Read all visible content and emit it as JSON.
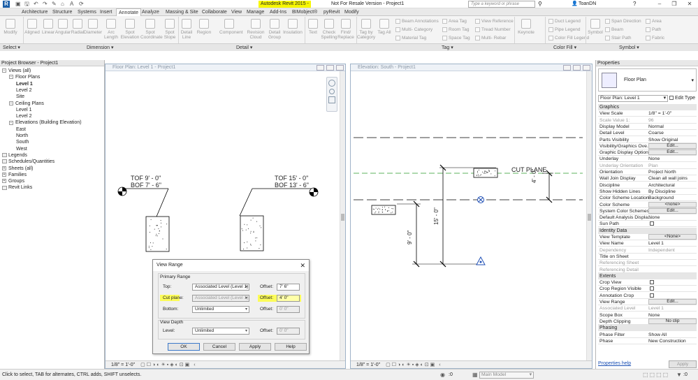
{
  "title_bar": {
    "app_title": "Autodesk Revit 2015 -",
    "suffix": "Not For Resale Version -   Project1",
    "search_placeholder": "Type a keyword or phrase",
    "user": "ToanDN",
    "quick_access": [
      "▣",
      "🖫",
      "↶",
      "↷",
      "✎",
      "⌂",
      "A",
      "⟳"
    ]
  },
  "ribbon_tabs": [
    "Architecture",
    "Structure",
    "Systems",
    "Insert",
    "Annotate",
    "Analyze",
    "Massing & Site",
    "Collaborate",
    "View",
    "Manage",
    "Add-Ins",
    "BIMobject®",
    "pyRevit",
    "Modify"
  ],
  "active_tab": "Annotate",
  "ribbon": {
    "tools_dimension": [
      "Modify",
      "Aligned",
      "Linear",
      "Angular",
      "Radial",
      "Diameter",
      "Arc Length",
      "Spot Elevation",
      "Spot Coordinate",
      "Spot Slope"
    ],
    "tools_detail": [
      "Detail Line",
      "Region",
      "Component",
      "Revision Cloud",
      "Detail Group",
      "Insulation"
    ],
    "tools_text": [
      "Text",
      "Check Spelling",
      "Find/ Replace"
    ],
    "tools_tag_big": [
      "Tag by Category",
      "Tag All"
    ],
    "tools_tag_small": [
      "Beam Annotations",
      "Multi- Category",
      "Material Tag",
      "Area Tag",
      "Room Tag",
      "Space Tag",
      "View Reference",
      "Tread Number",
      "Multi- Rebar"
    ],
    "tools_keynote": [
      "Keynote"
    ],
    "tools_color": [
      "Duct Legend",
      "Pipe Legend",
      "Color Fill Legend"
    ],
    "tools_symbol": [
      "Symbol",
      "Span Direction",
      "Beam",
      "Stair Path",
      "Area",
      "Path",
      "Fabric"
    ],
    "panels": [
      "Select",
      "Dimension",
      "Detail",
      "Tag",
      "Color Fill",
      "Symbol"
    ]
  },
  "project_browser": {
    "title": "Project Browser - Project1",
    "tree": [
      {
        "label": "Views (all)",
        "level": 0,
        "exp": "−"
      },
      {
        "label": "Floor Plans",
        "level": 1,
        "exp": "−"
      },
      {
        "label": "Level 1",
        "level": 2,
        "bold": true
      },
      {
        "label": "Level 2",
        "level": 2
      },
      {
        "label": "Site",
        "level": 2
      },
      {
        "label": "Ceiling Plans",
        "level": 1,
        "exp": "−"
      },
      {
        "label": "Level 1",
        "level": 2
      },
      {
        "label": "Level 2",
        "level": 2
      },
      {
        "label": "Elevations (Building Elevation)",
        "level": 1,
        "exp": "−"
      },
      {
        "label": "East",
        "level": 2
      },
      {
        "label": "North",
        "level": 2
      },
      {
        "label": "South",
        "level": 2
      },
      {
        "label": "West",
        "level": 2
      },
      {
        "label": "Legends",
        "level": 0
      },
      {
        "label": "Schedules/Quantities",
        "level": 0
      },
      {
        "label": "Sheets (all)",
        "level": 0,
        "exp": "+"
      },
      {
        "label": "Families",
        "level": 0,
        "exp": "+"
      },
      {
        "label": "Groups",
        "level": 0,
        "exp": "+"
      },
      {
        "label": "Revit Links",
        "level": 0
      }
    ]
  },
  "floor_plan_view": {
    "title": "Floor Plan: Level 1 - Project1",
    "scale": "1/8\" = 1'-0\"",
    "tag_left_line1": "TOF 9' - 0\"",
    "tag_left_line2": "BOF 7' - 6\"",
    "tag_right_line1": "TOF 15' - 0\"",
    "tag_right_line2": "BOF 13' - 6\""
  },
  "elevation_view": {
    "title": "Elevation: South - Project1",
    "scale": "1/8\" = 1'-0\"",
    "cut_plane_label": "CUT PLANE",
    "dim_4": "4' - 0\"",
    "dim_15": "15' - 0\"",
    "dim_9": "9' - 0\""
  },
  "view_range_dialog": {
    "title": "View Range",
    "primary_range": "Primary Range",
    "top_label": "Top:",
    "top_value": "Associated Level (Level 1)",
    "top_offset_label": "Offset:",
    "top_offset": "7' 6\"",
    "cut_label": "Cut plane:",
    "cut_value": "Associated Level (Level 1)",
    "cut_offset_label": "Offset:",
    "cut_offset": "4' 0\"",
    "bottom_label": "Bottom:",
    "bottom_value": "Unlimited",
    "bottom_offset_label": "Offset:",
    "bottom_offset": "0' 0\"",
    "view_depth": "View Depth",
    "depth_level_label": "Level:",
    "depth_level_value": "Unlimited",
    "depth_offset_label": "Offset:",
    "depth_offset": "0' 0\"",
    "ok": "OK",
    "cancel": "Cancel",
    "apply": "Apply",
    "help": "Help",
    "highlight_color": "#ffff33"
  },
  "properties": {
    "title": "Properties",
    "type_name": "Floor Plan",
    "instance": "Floor Plan: Level 1",
    "edit_type": "Edit Type",
    "rows": [
      {
        "sec": "Graphics"
      },
      {
        "k": "View Scale",
        "v": "1/8\" = 1'-0\""
      },
      {
        "k": "Scale Value    1:",
        "v": "96",
        "dis": true
      },
      {
        "k": "Display Model",
        "v": "Normal"
      },
      {
        "k": "Detail Level",
        "v": "Coarse"
      },
      {
        "k": "Parts Visibility",
        "v": "Show Original"
      },
      {
        "k": "Visibility/Graphics Ove...",
        "btn": "Edit..."
      },
      {
        "k": "Graphic Display Options",
        "btn": "Edit..."
      },
      {
        "k": "Underlay",
        "v": "None"
      },
      {
        "k": "Underlay Orientation",
        "v": "Plan",
        "dis": true
      },
      {
        "k": "Orientation",
        "v": "Project North"
      },
      {
        "k": "Wall Join Display",
        "v": "Clean all wall joins"
      },
      {
        "k": "Discipline",
        "v": "Architectural"
      },
      {
        "k": "Show Hidden Lines",
        "v": "By Discipline"
      },
      {
        "k": "Color Scheme Location",
        "v": "Background"
      },
      {
        "k": "Color Scheme",
        "btn": "<none>"
      },
      {
        "k": "System Color Schemes",
        "btn": "Edit..."
      },
      {
        "k": "Default Analysis Displa...",
        "v": "None"
      },
      {
        "k": "Sun Path",
        "cb": true
      },
      {
        "sec": "Identity Data"
      },
      {
        "k": "View Template",
        "btn": "<None>"
      },
      {
        "k": "View Name",
        "v": "Level 1"
      },
      {
        "k": "Dependency",
        "v": "Independent",
        "dis": true
      },
      {
        "k": "Title on Sheet",
        "v": ""
      },
      {
        "k": "Referencing Sheet",
        "v": "",
        "dis": true
      },
      {
        "k": "Referencing Detail",
        "v": "",
        "dis": true
      },
      {
        "sec": "Extents"
      },
      {
        "k": "Crop View",
        "cb": true
      },
      {
        "k": "Crop Region Visible",
        "cb": true
      },
      {
        "k": "Annotation Crop",
        "cb": true
      },
      {
        "k": "View Range",
        "btn": "Edit..."
      },
      {
        "k": "Associated Level",
        "v": "Level 1",
        "dis": true
      },
      {
        "k": "Scope Box",
        "v": "None"
      },
      {
        "k": "Depth Clipping",
        "btn": "No clip"
      },
      {
        "sec": "Phasing"
      },
      {
        "k": "Phase Filter",
        "v": "Show All"
      },
      {
        "k": "Phase",
        "v": "New Construction"
      }
    ],
    "help_link": "Properties help",
    "apply": "Apply"
  },
  "status_bar": {
    "hint": "Click to select, TAB for alternates, CTRL adds, SHIFT unselects.",
    "zero": ":0",
    "model": "Main Model",
    "filter": ":0"
  }
}
